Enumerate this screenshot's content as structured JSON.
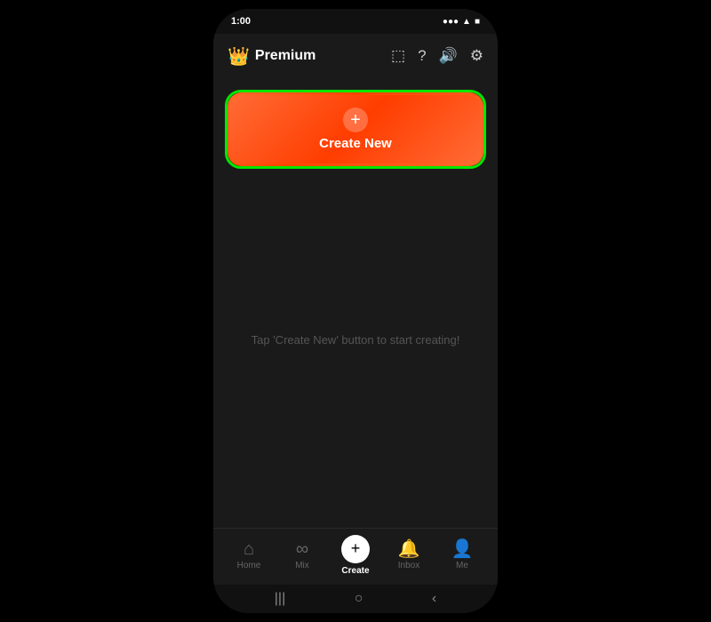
{
  "status_bar": {
    "time": "1:00",
    "signal": "●●●",
    "wifi": "▲",
    "battery": "■"
  },
  "top_nav": {
    "brand_name": "Premium",
    "crown_symbol": "👑",
    "icons": {
      "monitor": "⬚",
      "help": "?",
      "sound": "🔊",
      "settings": "⚙"
    }
  },
  "create_button": {
    "label": "Create New",
    "plus": "+"
  },
  "empty_state": {
    "text": "Tap 'Create New' button to start creating!"
  },
  "bottom_nav": {
    "items": [
      {
        "id": "home",
        "label": "Home",
        "icon": "⌂",
        "active": false
      },
      {
        "id": "mix",
        "label": "Mix",
        "icon": "∞",
        "active": false
      },
      {
        "id": "create",
        "label": "Create",
        "icon": "+",
        "active": true
      },
      {
        "id": "inbox",
        "label": "Inbox",
        "icon": "🔔",
        "active": false
      },
      {
        "id": "me",
        "label": "Me",
        "icon": "👤",
        "active": false
      }
    ]
  },
  "gesture_bar": {
    "icons": [
      "|||",
      "○",
      "<"
    ]
  }
}
